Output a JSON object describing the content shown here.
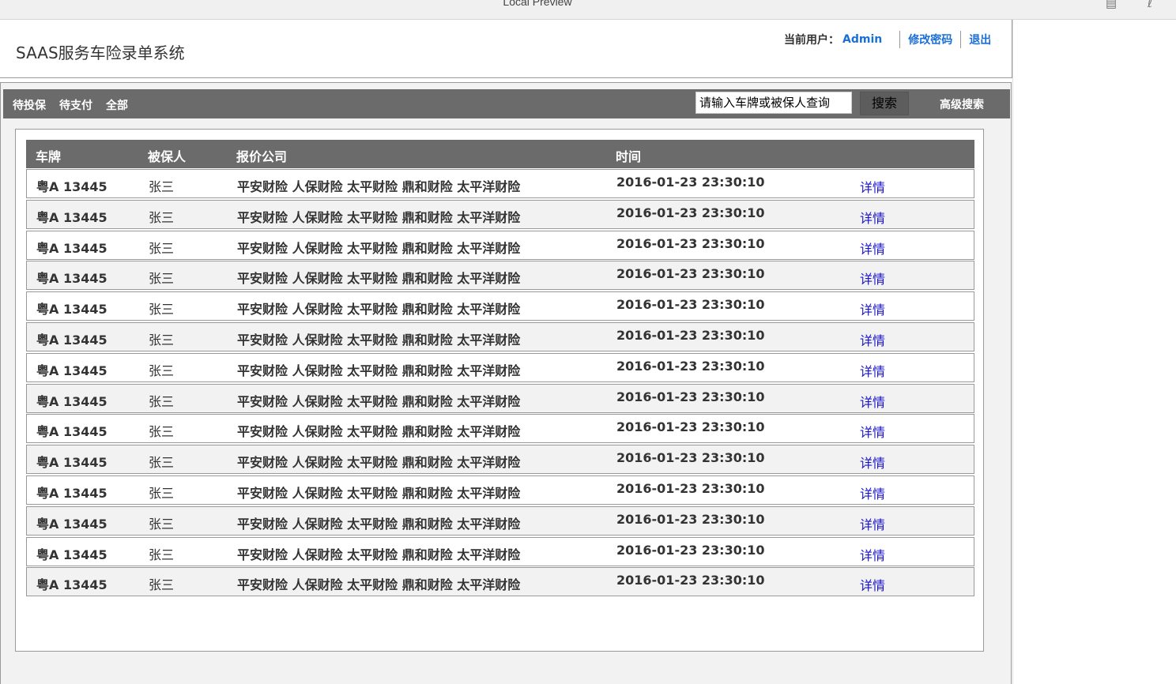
{
  "preview": {
    "title": "Local Preview"
  },
  "header": {
    "app_title": "SAAS服务车险录单系统",
    "current_user_label": "当前用户：",
    "current_user": "Admin",
    "change_password": "修改密码",
    "logout": "退出"
  },
  "toolbar": {
    "tabs": [
      {
        "label": "待投保"
      },
      {
        "label": "待支付"
      },
      {
        "label": "全部"
      }
    ],
    "search_placeholder": "请输入车牌或被保人查询",
    "search_button": "搜索",
    "advanced_search": "高级搜索"
  },
  "table": {
    "columns": [
      "车牌",
      "被保人",
      "报价公司",
      "时间"
    ],
    "rows": [
      {
        "plate": "粤A 13445",
        "name": "张三",
        "companies": "平安财险  人保财险  太平财险  鼎和财险  太平洋财险",
        "time": "2016-01-23 23:30:10",
        "action": "详情"
      },
      {
        "plate": "粤A 13445",
        "name": "张三",
        "companies": "平安财险  人保财险  太平财险  鼎和财险  太平洋财险",
        "time": "2016-01-23 23:30:10",
        "action": "详情"
      },
      {
        "plate": "粤A 13445",
        "name": "张三",
        "companies": "平安财险  人保财险  太平财险  鼎和财险  太平洋财险",
        "time": "2016-01-23 23:30:10",
        "action": "详情"
      },
      {
        "plate": "粤A 13445",
        "name": "张三",
        "companies": "平安财险  人保财险  太平财险  鼎和财险  太平洋财险",
        "time": "2016-01-23 23:30:10",
        "action": "详情"
      },
      {
        "plate": "粤A 13445",
        "name": "张三",
        "companies": "平安财险  人保财险  太平财险  鼎和财险  太平洋财险",
        "time": "2016-01-23 23:30:10",
        "action": "详情"
      },
      {
        "plate": "粤A 13445",
        "name": "张三",
        "companies": "平安财险  人保财险  太平财险  鼎和财险  太平洋财险",
        "time": "2016-01-23 23:30:10",
        "action": "详情"
      },
      {
        "plate": "粤A 13445",
        "name": "张三",
        "companies": "平安财险  人保财险  太平财险  鼎和财险  太平洋财险",
        "time": "2016-01-23 23:30:10",
        "action": "详情"
      },
      {
        "plate": "粤A 13445",
        "name": "张三",
        "companies": "平安财险  人保财险  太平财险  鼎和财险  太平洋财险",
        "time": "2016-01-23 23:30:10",
        "action": "详情"
      },
      {
        "plate": "粤A 13445",
        "name": "张三",
        "companies": "平安财险  人保财险  太平财险  鼎和财险  太平洋财险",
        "time": "2016-01-23 23:30:10",
        "action": "详情"
      },
      {
        "plate": "粤A 13445",
        "name": "张三",
        "companies": "平安财险  人保财险  太平财险  鼎和财险  太平洋财险",
        "time": "2016-01-23 23:30:10",
        "action": "详情"
      },
      {
        "plate": "粤A 13445",
        "name": "张三",
        "companies": "平安财险  人保财险  太平财险  鼎和财险  太平洋财险",
        "time": "2016-01-23 23:30:10",
        "action": "详情"
      },
      {
        "plate": "粤A 13445",
        "name": "张三",
        "companies": "平安财险  人保财险  太平财险  鼎和财险  太平洋财险",
        "time": "2016-01-23 23:30:10",
        "action": "详情"
      },
      {
        "plate": "粤A 13445",
        "name": "张三",
        "companies": "平安财险  人保财险  太平财险  鼎和财险  太平洋财险",
        "time": "2016-01-23 23:30:10",
        "action": "详情"
      },
      {
        "plate": "粤A 13445",
        "name": "张三",
        "companies": "平安财险  人保财险  太平财险  鼎和财险  太平洋财险",
        "time": "2016-01-23 23:30:10",
        "action": "详情"
      }
    ]
  },
  "icons": {
    "preview_left": "document-icon",
    "preview_right": "pdf-icon"
  },
  "colors": {
    "toolbar_bg": "#6b6b6b",
    "link_blue": "#1a6fd6",
    "detail_link": "#1a14c8"
  }
}
